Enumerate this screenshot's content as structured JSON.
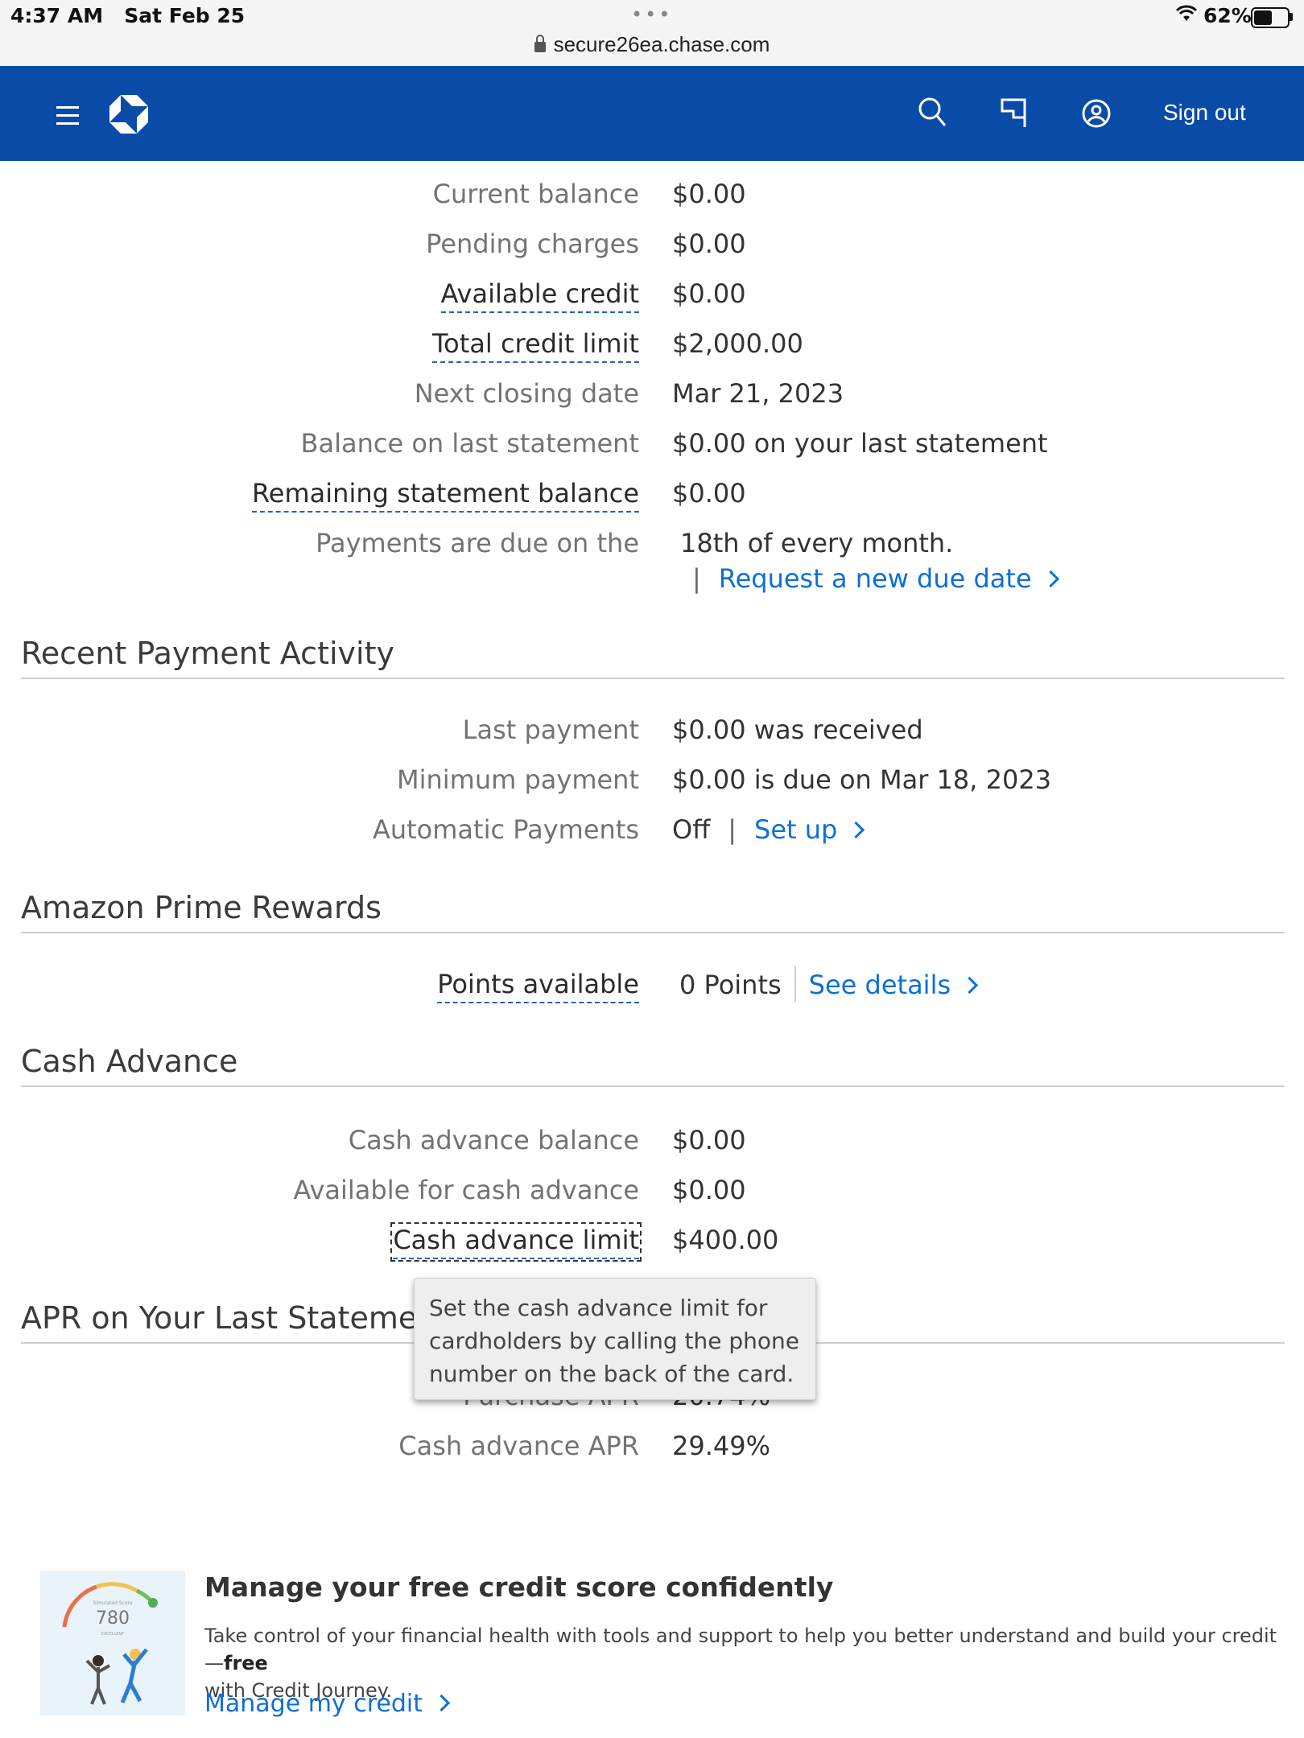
{
  "status_bar": {
    "time": "4:37 AM",
    "date": "Sat Feb 25",
    "battery": "62%",
    "battery_level": 0.62,
    "url": "secure26ea.chase.com"
  },
  "header": {
    "sign_out": "Sign out",
    "icons": [
      "menu-icon",
      "chase-logo",
      "search-icon",
      "flag-icon",
      "profile-icon"
    ]
  },
  "account_summary": [
    {
      "label": "Current balance",
      "value": "$0.00"
    },
    {
      "label": "Pending charges",
      "value": "$0.00"
    },
    {
      "label": "Available credit",
      "value": "$0.00"
    },
    {
      "label": "Total credit limit",
      "value": "$2,000.00"
    },
    {
      "label": "Next closing date",
      "value": "Mar 21, 2023"
    },
    {
      "label": "Balance on last statement",
      "value": "$0.00 on your last statement"
    },
    {
      "label": "Remaining statement balance",
      "value": "$0.00"
    },
    {
      "label": "Payments are due on the",
      "value": "18th of every month.",
      "link": "Request a new due date"
    }
  ],
  "recent_payment": {
    "title": "Recent Payment Activity",
    "rows": [
      {
        "label": "Last payment",
        "value": "$0.00 was received"
      },
      {
        "label": "Minimum payment",
        "value": "$0.00 is due on Mar 18, 2023"
      },
      {
        "label": "Automatic Payments",
        "value": "Off",
        "link": "Set up"
      }
    ]
  },
  "rewards": {
    "title": "Amazon Prime Rewards",
    "label": "Points available",
    "value": "0 Points",
    "link": "See details"
  },
  "cash_advance": {
    "title": "Cash Advance",
    "rows": [
      {
        "label": "Cash advance balance",
        "value": "$0.00"
      },
      {
        "label": "Available for cash advance",
        "value": "$0.00"
      },
      {
        "label": "Cash advance limit",
        "value": "$400.00"
      }
    ],
    "tooltip": [
      "Set the cash advance limit for",
      "cardholders by calling the phone",
      "number on the back of the card."
    ]
  },
  "apr": {
    "title": "APR on Your Last Statement",
    "rows": [
      {
        "label": "Purchase APR",
        "value": "20.74%"
      },
      {
        "label": "Cash advance APR",
        "value": "29.49%"
      }
    ]
  },
  "promo": {
    "gauge_caption": "Simulated Score",
    "score": "780",
    "score_rating": "EXCELLENT",
    "title": "Manage your free credit score confidently",
    "text_before_bold": "Take control of your financial health with tools and support to help you better understand and build your credit—",
    "text_bold": "free",
    "text_after": "with Credit Journey.",
    "link": "Manage my credit"
  }
}
